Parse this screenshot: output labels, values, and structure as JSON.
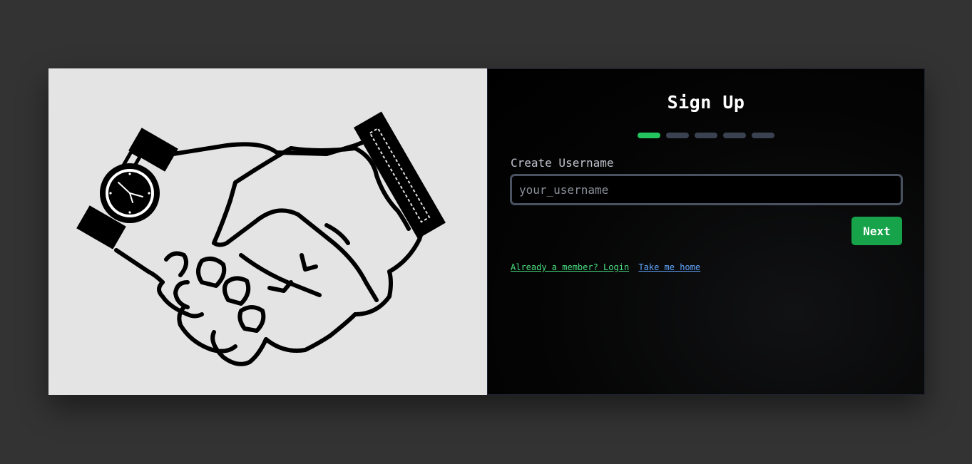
{
  "form": {
    "title": "Sign Up",
    "steps": {
      "total": 5,
      "current": 1
    },
    "username_label": "Create Username",
    "username_placeholder": "your_username",
    "username_value": "",
    "next_label": "Next"
  },
  "links": {
    "login_label": "Already a member? Login",
    "home_label": "Take me home"
  },
  "colors": {
    "page_background": "#333333",
    "illustration_background": "#e4e4e4",
    "panel_background": "#000000",
    "accent_green": "#16a34a",
    "step_active": "#22c55e",
    "step_inactive": "#3a4252",
    "login_link": "#4ade80",
    "home_link": "#60a5fa"
  },
  "illustration": {
    "icon": "handshake-icon"
  }
}
